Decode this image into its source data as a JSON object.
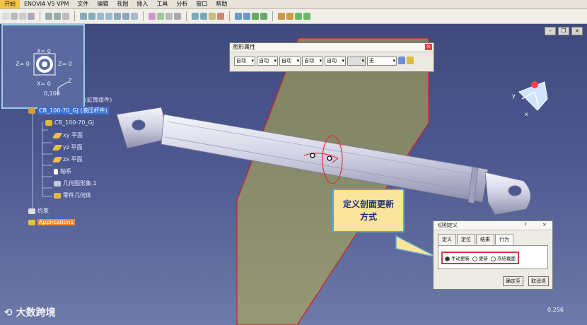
{
  "menubar": {
    "items": [
      "开始",
      "ENOVIA V5 VPM",
      "文件",
      "编辑",
      "视图",
      "插入",
      "工具",
      "分析",
      "窗口",
      "帮助"
    ],
    "active": 0
  },
  "compass": {
    "z_left": "Z=  0",
    "x_top": "X=  0",
    "z_right": "Z=  0",
    "x_bottom": "X=  0",
    "scale": "0,100",
    "axis_z": "Z"
  },
  "tree": {
    "root_partial": "(缸筒组件)",
    "product": "CB_100-70_GJ (液压杆件)",
    "part": "CB_100-70_GJ",
    "xy": "xy 平面",
    "yz": "yz 平面",
    "zx": "zx 平面",
    "axis": "轴系",
    "geoset": "几何图形集.1",
    "body": "零件几何体",
    "constraints": "约束",
    "applications": "Applications"
  },
  "prop_toolbar": {
    "title": "图形属性",
    "combos": [
      "自动",
      "自动",
      "自动",
      "自动",
      "自动",
      "",
      "无"
    ]
  },
  "callout": {
    "line1": "定义剖面更新",
    "line2": "方式"
  },
  "section_dialog": {
    "title": "切割定义",
    "help": "?",
    "close": "×",
    "tabs": [
      "定义",
      "定位",
      "结果",
      "行为"
    ],
    "options": [
      "手动更新",
      "更新",
      "冻结截面"
    ],
    "selected": 0,
    "ok": "确定至",
    "cancel": "取消退"
  },
  "watermark": "大数跨境",
  "view_scale": "0,256",
  "colors": {
    "accent": "#f5c24a",
    "selection": "#3a6fd0",
    "plane": "#b7b34a",
    "callout_bg": "#fbe59c"
  }
}
